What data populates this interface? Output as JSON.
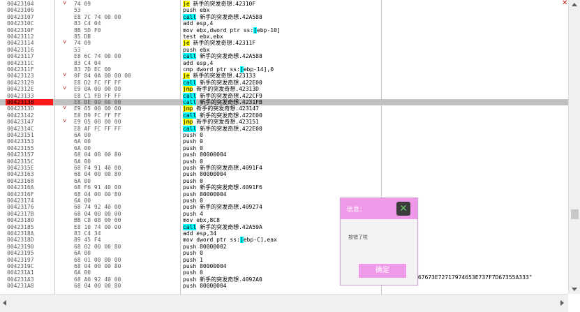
{
  "rows": [
    {
      "addr": "00423104",
      "arrow": "˅",
      "bytes": "74 09",
      "pre": "",
      "mn": "je",
      "post": " 新手的突发奇想.42310F",
      "mnStyle": "yellow"
    },
    {
      "addr": "00423106",
      "arrow": "",
      "bytes": "53",
      "pre": "",
      "mn": "",
      "post": "push ebx",
      "mnStyle": ""
    },
    {
      "addr": "00423107",
      "arrow": "",
      "bytes": "E8 7C 74 00 00",
      "pre": "",
      "mn": "call",
      "post": " 新手的突发奇想.42A588",
      "mnStyle": "cyan"
    },
    {
      "addr": "0042310C",
      "arrow": "",
      "bytes": "83 C4 04",
      "pre": "",
      "mn": "",
      "post": "add esp,4",
      "mnStyle": ""
    },
    {
      "addr": "0042310F",
      "arrow": "",
      "bytes": "8B 5D F0",
      "pre": "mov ebx,dword ptr ss:",
      "mn": "[",
      "post": "ebp-10]",
      "mnStyle": "bracket"
    },
    {
      "addr": "00423112",
      "arrow": "",
      "bytes": "85 DB",
      "pre": "",
      "mn": "",
      "post": "test ebx,ebx",
      "mnStyle": ""
    },
    {
      "addr": "00423114",
      "arrow": "˅",
      "bytes": "74 09",
      "pre": "",
      "mn": "je",
      "post": " 新手的突发奇想.42311F",
      "mnStyle": "yellow"
    },
    {
      "addr": "00423116",
      "arrow": "",
      "bytes": "53",
      "pre": "",
      "mn": "",
      "post": "push ebx",
      "mnStyle": ""
    },
    {
      "addr": "00423117",
      "arrow": "",
      "bytes": "E8 6C 74 00 00",
      "pre": "",
      "mn": "call",
      "post": " 新手的突发奇想.42A588",
      "mnStyle": "cyan"
    },
    {
      "addr": "0042311C",
      "arrow": "",
      "bytes": "83 C4 04",
      "pre": "",
      "mn": "",
      "post": "add esp,4",
      "mnStyle": ""
    },
    {
      "addr": "0042311F",
      "arrow": "",
      "bytes": "83 7D EC 00",
      "pre": "cmp dword ptr ss:",
      "mn": "[",
      "post": "ebp-14],0",
      "mnStyle": "bracket"
    },
    {
      "addr": "00423123",
      "arrow": "˅",
      "bytes": "0F 84 0A 00 00 00",
      "pre": "",
      "mn": "je",
      "post": " 新手的突发奇想.423133",
      "mnStyle": "yellow"
    },
    {
      "addr": "00423129",
      "arrow": "",
      "bytes": "E8 D2 FC FF FF",
      "pre": "",
      "mn": "call",
      "post": " 新手的突发奇想.422E00",
      "mnStyle": "cyan"
    },
    {
      "addr": "0042312E",
      "arrow": "˅",
      "bytes": "E9 0A 00 00 00",
      "pre": "",
      "mn": "jmp",
      "post": " 新手的突发奇想.42313D",
      "mnStyle": "yellow"
    },
    {
      "addr": "00423133",
      "arrow": "",
      "bytes": "E8 C1 FB FF FF",
      "pre": "",
      "mn": "call",
      "post": " 新手的突发奇想.422CF9",
      "mnStyle": "cyan"
    },
    {
      "addr": "00423138",
      "arrow": "",
      "bytes": "E8 BE 00 00 00",
      "pre": "",
      "mn": "call",
      "post": " 新手的突发奇想.4231FB",
      "mnStyle": "cyan",
      "highlight": true
    },
    {
      "addr": "0042313D",
      "arrow": "˅",
      "bytes": "E9 05 00 00 00",
      "pre": "",
      "mn": "jmp",
      "post": " 新手的突发奇想.423147",
      "mnStyle": "yellow"
    },
    {
      "addr": "00423142",
      "arrow": "",
      "bytes": "E8 B9 FC FF FF",
      "pre": "",
      "mn": "call",
      "post": " 新手的突发奇想.422E00",
      "mnStyle": "cyan"
    },
    {
      "addr": "00423147",
      "arrow": "˅",
      "bytes": "E9 05 00 00 00",
      "pre": "",
      "mn": "jmp",
      "post": " 新手的突发奇想.423151",
      "mnStyle": "yellow"
    },
    {
      "addr": "0042314C",
      "arrow": "",
      "bytes": "E8 AF FC FF FF",
      "pre": "",
      "mn": "call",
      "post": " 新手的突发奇想.422E00",
      "mnStyle": "cyan"
    },
    {
      "addr": "00423151",
      "arrow": "",
      "bytes": "6A 00",
      "pre": "",
      "mn": "",
      "post": "push 0",
      "mnStyle": ""
    },
    {
      "addr": "00423153",
      "arrow": "",
      "bytes": "6A 00",
      "pre": "",
      "mn": "",
      "post": "push 0",
      "mnStyle": ""
    },
    {
      "addr": "00423155",
      "arrow": "",
      "bytes": "6A 00",
      "pre": "",
      "mn": "",
      "post": "push 0",
      "mnStyle": ""
    },
    {
      "addr": "00423157",
      "arrow": "",
      "bytes": "68 04 00 00 80",
      "pre": "",
      "mn": "",
      "post": "push 80000004",
      "mnStyle": ""
    },
    {
      "addr": "0042315C",
      "arrow": "",
      "bytes": "6A 00",
      "pre": "",
      "mn": "",
      "post": "push 0",
      "mnStyle": ""
    },
    {
      "addr": "0042315E",
      "arrow": "",
      "bytes": "68 F4 91 40 00",
      "pre": "",
      "mn": "",
      "post": "push 新手的突发奇想.4091F4",
      "mnStyle": ""
    },
    {
      "addr": "00423163",
      "arrow": "",
      "bytes": "68 04 00 00 80",
      "pre": "",
      "mn": "",
      "post": "push 80000004",
      "mnStyle": ""
    },
    {
      "addr": "00423168",
      "arrow": "",
      "bytes": "6A 00",
      "pre": "",
      "mn": "",
      "post": "push 0",
      "mnStyle": ""
    },
    {
      "addr": "0042316A",
      "arrow": "",
      "bytes": "68 F6 91 40 00",
      "pre": "",
      "mn": "",
      "post": "push 新手的突发奇想.4091F6",
      "mnStyle": ""
    },
    {
      "addr": "0042316F",
      "arrow": "",
      "bytes": "68 04 00 00 80",
      "pre": "",
      "mn": "",
      "post": "push 80000004",
      "mnStyle": ""
    },
    {
      "addr": "00423174",
      "arrow": "",
      "bytes": "6A 00",
      "pre": "",
      "mn": "",
      "post": "push 0",
      "mnStyle": ""
    },
    {
      "addr": "00423176",
      "arrow": "",
      "bytes": "68 74 92 40 00",
      "pre": "",
      "mn": "",
      "post": "push 新手的突发奇想.409274",
      "mnStyle": ""
    },
    {
      "addr": "0042317B",
      "arrow": "",
      "bytes": "68 04 00 00 00",
      "pre": "",
      "mn": "",
      "post": "push 4",
      "mnStyle": ""
    },
    {
      "addr": "00423180",
      "arrow": "",
      "bytes": "BB C8 08 00 00",
      "pre": "",
      "mn": "",
      "post": "mov ebx,8C8",
      "mnStyle": ""
    },
    {
      "addr": "00423185",
      "arrow": "",
      "bytes": "E8 10 74 00 00",
      "pre": "",
      "mn": "call",
      "post": " 新手的突发奇想.42A59A",
      "mnStyle": "cyan"
    },
    {
      "addr": "0042318A",
      "arrow": "",
      "bytes": "83 C4 34",
      "pre": "",
      "mn": "",
      "post": "add esp,34",
      "mnStyle": ""
    },
    {
      "addr": "0042318D",
      "arrow": "",
      "bytes": "89 45 F4",
      "pre": "mov dword ptr ss:",
      "mn": "[",
      "post": "ebp-C],eax",
      "mnStyle": "bracket"
    },
    {
      "addr": "00423190",
      "arrow": "",
      "bytes": "68 02 00 00 80",
      "pre": "",
      "mn": "",
      "post": "push 80000002",
      "mnStyle": ""
    },
    {
      "addr": "00423195",
      "arrow": "",
      "bytes": "6A 00",
      "pre": "",
      "mn": "",
      "post": "push 0",
      "mnStyle": ""
    },
    {
      "addr": "00423197",
      "arrow": "",
      "bytes": "68 01 00 00 00",
      "pre": "",
      "mn": "",
      "post": "push 1",
      "mnStyle": ""
    },
    {
      "addr": "0042319C",
      "arrow": "",
      "bytes": "68 04 00 00 80",
      "pre": "",
      "mn": "",
      "post": "push 80000004",
      "mnStyle": ""
    },
    {
      "addr": "004231A1",
      "arrow": "",
      "bytes": "6A 00",
      "pre": "",
      "mn": "",
      "post": "push 0",
      "mnStyle": ""
    },
    {
      "addr": "004231A3",
      "arrow": "",
      "bytes": "68 A0 92 40 00",
      "pre": "",
      "mn": "",
      "post": "push 新手的突发奇想.4092A0",
      "mnStyle": ""
    },
    {
      "addr": "004231A8",
      "arrow": "",
      "bytes": "68 04 00 00 80",
      "pre": "",
      "mn": "",
      "post": "push 80000004",
      "mnStyle": ""
    }
  ],
  "overflow_text": "767673E72717974653E737F7D67355A333\"",
  "close_glyph": "✕",
  "dialog": {
    "title": "信息：",
    "message": "按错了啦",
    "ok_label": "确定",
    "close_glyph": "✕",
    "accent": "#ee9ae8"
  },
  "colors": {
    "highlight_row": "#c0c0c0",
    "current_addr": "#ff1a1a",
    "jump_mnemonic": "#ffff00",
    "call_mnemonic": "#00ffff"
  }
}
